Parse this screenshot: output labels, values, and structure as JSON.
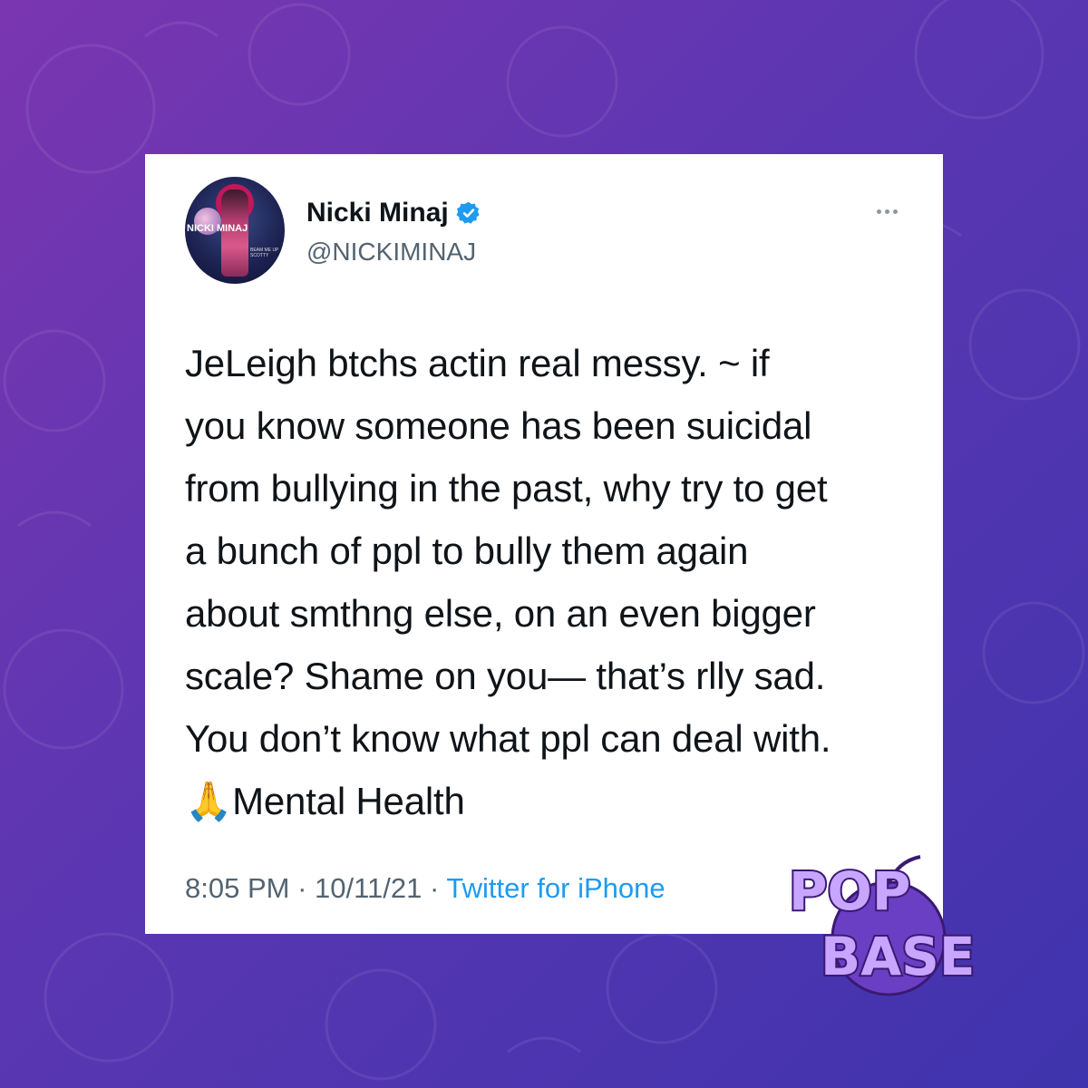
{
  "tweet": {
    "display_name": "Nicki Minaj",
    "handle": "@NICKIMINAJ",
    "verified_icon": "verified-badge-icon",
    "avatar_text": "NICKI MINAJ",
    "avatar_small_text": "BEAM ME UP SCOTTY",
    "text_lines": [
      "JeLeigh btchs actin real messy. ~ if",
      "you know someone has been suicidal",
      "from bullying in the past, why try to get",
      "a bunch of ppl to bully them again",
      "about smthng else, on an even bigger",
      "scale? Shame on you— that’s rlly sad.",
      "You don’t know what ppl can deal with.",
      "🙏Mental Health"
    ],
    "time": "8:05 PM",
    "date": "10/11/21",
    "source": "Twitter for iPhone",
    "separator": " · "
  },
  "logo": {
    "line1": "POP",
    "line2": "BASE"
  },
  "colors": {
    "background_start": "#7a36b0",
    "background_end": "#3f34ad",
    "verified": "#1d9bf0",
    "link": "#1d9bf0",
    "muted": "#536471",
    "logo_fill": "#c8a6ff"
  }
}
